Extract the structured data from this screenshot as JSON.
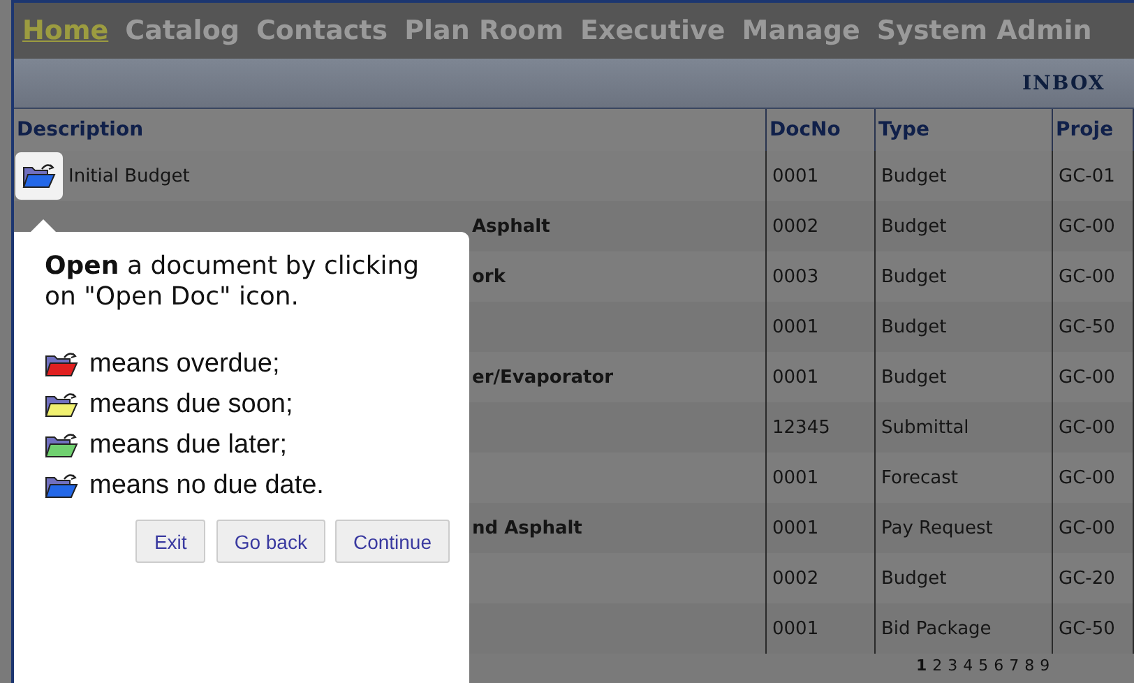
{
  "nav": [
    {
      "label": "Home",
      "selected": true
    },
    {
      "label": "Catalog",
      "selected": false
    },
    {
      "label": "Contacts",
      "selected": false
    },
    {
      "label": "Plan Room",
      "selected": false
    },
    {
      "label": "Executive",
      "selected": false
    },
    {
      "label": "Manage",
      "selected": false
    },
    {
      "label": "System Admin",
      "selected": false
    }
  ],
  "table": {
    "title": "INBOX",
    "columns": [
      "Description",
      "DocNo",
      "Type",
      "Proje"
    ],
    "rows": [
      {
        "highlighted": true,
        "cells": [
          "Initial Budget",
          "0001",
          "Budget",
          "GC-01"
        ]
      },
      {
        "highlighted": false,
        "cells": [
          "Asphalt",
          "0002",
          "Budget",
          "GC-00"
        ]
      },
      {
        "highlighted": false,
        "cells": [
          "ork",
          "0003",
          "Budget",
          "GC-00"
        ]
      },
      {
        "highlighted": false,
        "cells": [
          "",
          "0001",
          "Budget",
          "GC-50"
        ]
      },
      {
        "highlighted": false,
        "cells": [
          "er/Evaporator",
          "0001",
          "Budget",
          "GC-00"
        ]
      },
      {
        "highlighted": false,
        "cells": [
          "",
          "12345",
          "Submittal",
          "GC-00"
        ]
      },
      {
        "highlighted": false,
        "cells": [
          "",
          "0001",
          "Forecast",
          "GC-00"
        ]
      },
      {
        "highlighted": false,
        "cells": [
          "nd Asphalt",
          "0001",
          "Pay Request",
          "GC-00"
        ]
      },
      {
        "highlighted": false,
        "cells": [
          "",
          "0002",
          "Budget",
          "GC-20"
        ]
      },
      {
        "highlighted": false,
        "cells": [
          "",
          "0001",
          "Bid Package",
          "GC-50"
        ]
      }
    ],
    "pages": [
      {
        "label": "1",
        "selected": true
      },
      {
        "label": "2",
        "selected": false
      },
      {
        "label": "3",
        "selected": false
      },
      {
        "label": "4",
        "selected": false
      },
      {
        "label": "5",
        "selected": false
      },
      {
        "label": "6",
        "selected": false
      },
      {
        "label": "7",
        "selected": false
      },
      {
        "label": "8",
        "selected": false
      },
      {
        "label": "9",
        "selected": false
      }
    ]
  },
  "tooltip": {
    "text": "**Open** a document by clicking on \"Open Doc\" icon.",
    "legend": [
      {
        "color": "#e02020",
        "text": "means overdue;"
      },
      {
        "color": "#f0f070",
        "text": "means due soon;"
      },
      {
        "color": "#70d070",
        "text": "means due later;"
      },
      {
        "color": "#2468e8",
        "text": "means no due date."
      }
    ],
    "buttons": [
      "Exit",
      "Go back",
      "Continue"
    ]
  }
}
